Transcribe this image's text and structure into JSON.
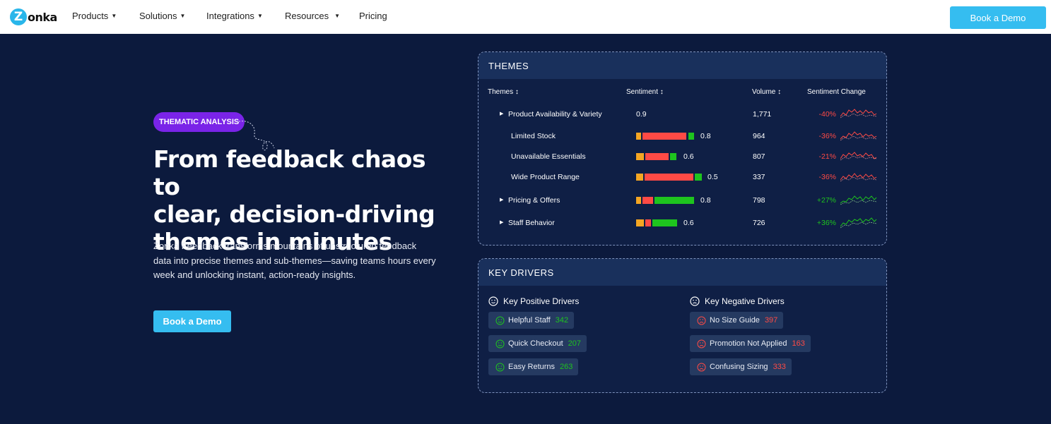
{
  "nav": {
    "logo_mark": "Z",
    "logo_text": "onka",
    "items": [
      "Products",
      "Solutions",
      "Integrations",
      "Resources",
      "Pricing"
    ],
    "cta": "Book a Demo"
  },
  "hero": {
    "tag": "THEMATIC ANALYSIS",
    "headline_lines": [
      "From feedback chaos to",
      "clear, decision-driving",
      "themes in minutes"
    ],
    "desc_lines": [
      "Zonka Feedback transforms mountains of unstructured feedback",
      "data into precise themes and sub-themes—saving teams hours every",
      "week and unlocking instant, action-ready insights."
    ],
    "cta": "Book a Demo"
  },
  "themes": {
    "title": "THEMES",
    "columns": [
      "Themes ↕",
      "Sentiment ↕",
      "Volume ↕",
      "Sentiment Change"
    ],
    "rows": [
      {
        "name": "Product Availability & Variety",
        "sentiment": "0.9",
        "volume": "1,771",
        "change": "-40%",
        "trend": "negative"
      },
      {
        "name": "Limited Stock",
        "sentiment": "0.8",
        "volume": "964",
        "change": "-36%",
        "trend": "negative"
      },
      {
        "name": "Unavailable Essentials",
        "sentiment": "0.6",
        "volume": "807",
        "change": "-21%",
        "trend": "negative"
      },
      {
        "name": "Wide Product Range",
        "sentiment": "0.5",
        "volume": "337",
        "change": "-36%",
        "trend": "negative"
      },
      {
        "name": "Pricing & Offers",
        "sentiment": "0.8",
        "volume": "798",
        "change": "+27%",
        "trend": "positive"
      },
      {
        "name": "Staff Behavior",
        "sentiment": "0.6",
        "volume": "726",
        "change": "+36%",
        "trend": "positive"
      }
    ]
  },
  "drivers": {
    "title": "KEY DRIVERS",
    "positive_title": "Key Positive Drivers",
    "negative_title": "Key Negative Drivers",
    "positive": [
      {
        "label": "Helpful Staff",
        "count": "342"
      },
      {
        "label": "Quick Checkout",
        "count": "207"
      },
      {
        "label": "Easy Returns",
        "count": "263"
      }
    ],
    "negative": [
      {
        "label": "No Size Guide",
        "count": "397"
      },
      {
        "label": "Promotion Not Applied",
        "count": "163"
      },
      {
        "label": "Confusing Sizing",
        "count": "333"
      }
    ]
  },
  "colors": {
    "accent": "#35bdf0",
    "tag": "#7a24e8",
    "negative": "#ff4a45",
    "positive": "#1ec41e",
    "neutral": "#f5a623"
  }
}
